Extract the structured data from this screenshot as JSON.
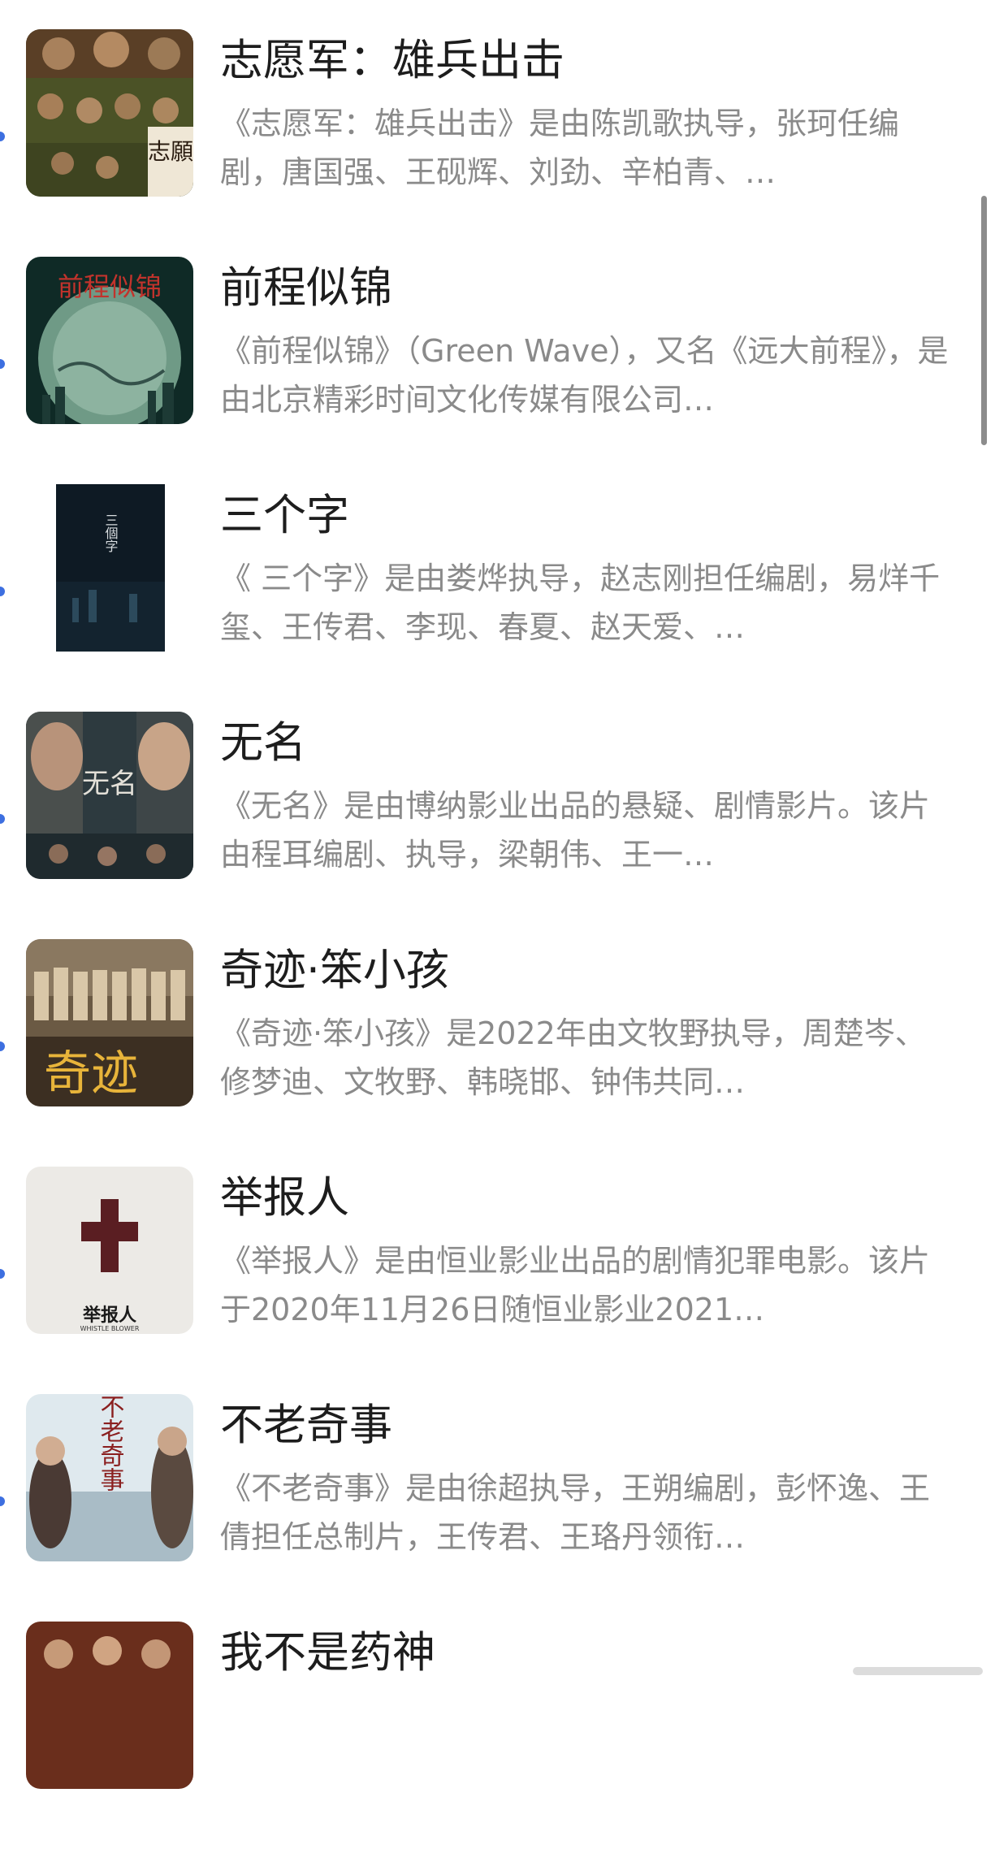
{
  "colors": {
    "title": "#1d1d1d",
    "description": "#8a8a8a",
    "dot": "#3d6fe0",
    "scrollbar": "#8c8c8c"
  },
  "items": [
    {
      "title": "志愿军：雄兵出击",
      "description": "《志愿军：雄兵出击》是由陈凯歌执导，张珂任编剧，唐国强、王砚辉、刘劲、辛柏青、…",
      "poster_text": "志願"
    },
    {
      "title": "前程似锦",
      "description": "《前程似锦》（Green Wave），又名《远大前程》，是由北京精彩时间文化传媒有限公司…",
      "poster_text": "前程似锦"
    },
    {
      "title": "三个字",
      "description": "《 三个字》是由娄烨执导，赵志刚担任编剧，易烊千玺、王传君、李现、春夏、赵天爱、…",
      "poster_text": "三個字"
    },
    {
      "title": "无名",
      "description": "《无名》是由博纳影业出品的悬疑、剧情影片。该片由程耳编剧、执导，梁朝伟、王一…",
      "poster_text": "无名"
    },
    {
      "title": "奇迹·笨小孩",
      "description": "《奇迹·笨小孩》是2022年由文牧野执导，周楚岑、修梦迪、文牧野、韩晓邯、钟伟共同…",
      "poster_text": "奇迹"
    },
    {
      "title": "举报人",
      "description": "《举报人》是由恒业影业出品的剧情犯罪电影。该片于2020年11月26日随恒业影业2021…",
      "poster_text": "举报人",
      "poster_subtext": "WHISTLE BLOWER"
    },
    {
      "title": "不老奇事",
      "description": "《不老奇事》是由徐超执导，王朔编剧，彭怀逸、王倩担任总制片，王传君、王珞丹领衔…",
      "poster_text": "不老奇事"
    },
    {
      "title": "我不是药神",
      "description": "",
      "poster_text": ""
    }
  ]
}
